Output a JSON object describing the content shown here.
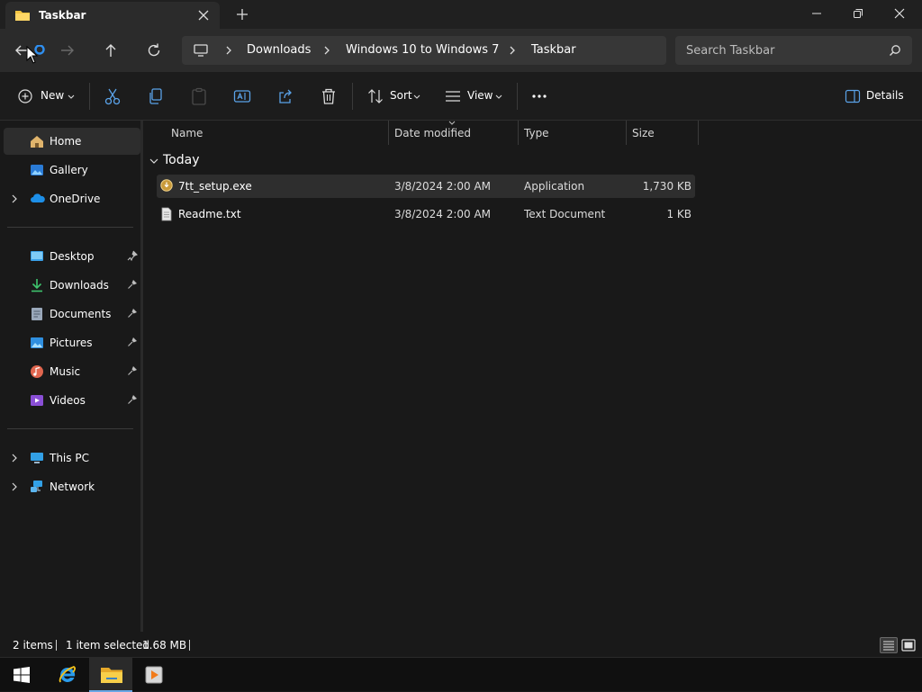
{
  "window": {
    "tab_title": "Taskbar",
    "colors": {
      "background": "#191919",
      "accent": "#6aa7e6",
      "folder": "#f4c542"
    }
  },
  "nav": {
    "breadcrumbs": [
      "Downloads",
      "Windows 10 to Windows 7",
      "Taskbar"
    ],
    "search_placeholder": "Search Taskbar"
  },
  "commands": {
    "new_label": "New",
    "sort_label": "Sort",
    "view_label": "View",
    "details_label": "Details",
    "icons": [
      "cut-icon",
      "copy-icon",
      "paste-icon",
      "rename-icon",
      "share-icon",
      "delete-icon",
      "more-icon"
    ]
  },
  "sidebar": {
    "items": [
      {
        "label": "Home",
        "icon": "home-icon"
      },
      {
        "label": "Gallery",
        "icon": "gallery-icon"
      },
      {
        "label": "OneDrive",
        "icon": "onedrive-icon"
      },
      {
        "label": "Desktop",
        "icon": "desktop-icon",
        "pinned": true
      },
      {
        "label": "Downloads",
        "icon": "downloads-icon",
        "pinned": true
      },
      {
        "label": "Documents",
        "icon": "documents-icon",
        "pinned": true
      },
      {
        "label": "Pictures",
        "icon": "pictures-icon",
        "pinned": true
      },
      {
        "label": "Music",
        "icon": "music-icon",
        "pinned": true
      },
      {
        "label": "Videos",
        "icon": "videos-icon",
        "pinned": true
      },
      {
        "label": "This PC",
        "icon": "this-pc-icon"
      },
      {
        "label": "Network",
        "icon": "network-icon"
      }
    ]
  },
  "filelist": {
    "columns": [
      "Name",
      "Date modified",
      "Type",
      "Size"
    ],
    "group": "Today",
    "rows": [
      {
        "name": "7tt_setup.exe",
        "date": "3/8/2024 2:00 AM",
        "type": "Application",
        "size": "1,730 KB",
        "selected": true
      },
      {
        "name": "Readme.txt",
        "date": "3/8/2024 2:00 AM",
        "type": "Text Document",
        "size": "1 KB",
        "selected": false
      }
    ]
  },
  "status": {
    "item_count": "2 items",
    "selection": "1 item selected",
    "selection_size": "1.68 MB"
  },
  "taskbar": {
    "apps": [
      "start-icon",
      "internet-explorer-icon",
      "file-explorer-icon",
      "media-player-icon"
    ]
  }
}
